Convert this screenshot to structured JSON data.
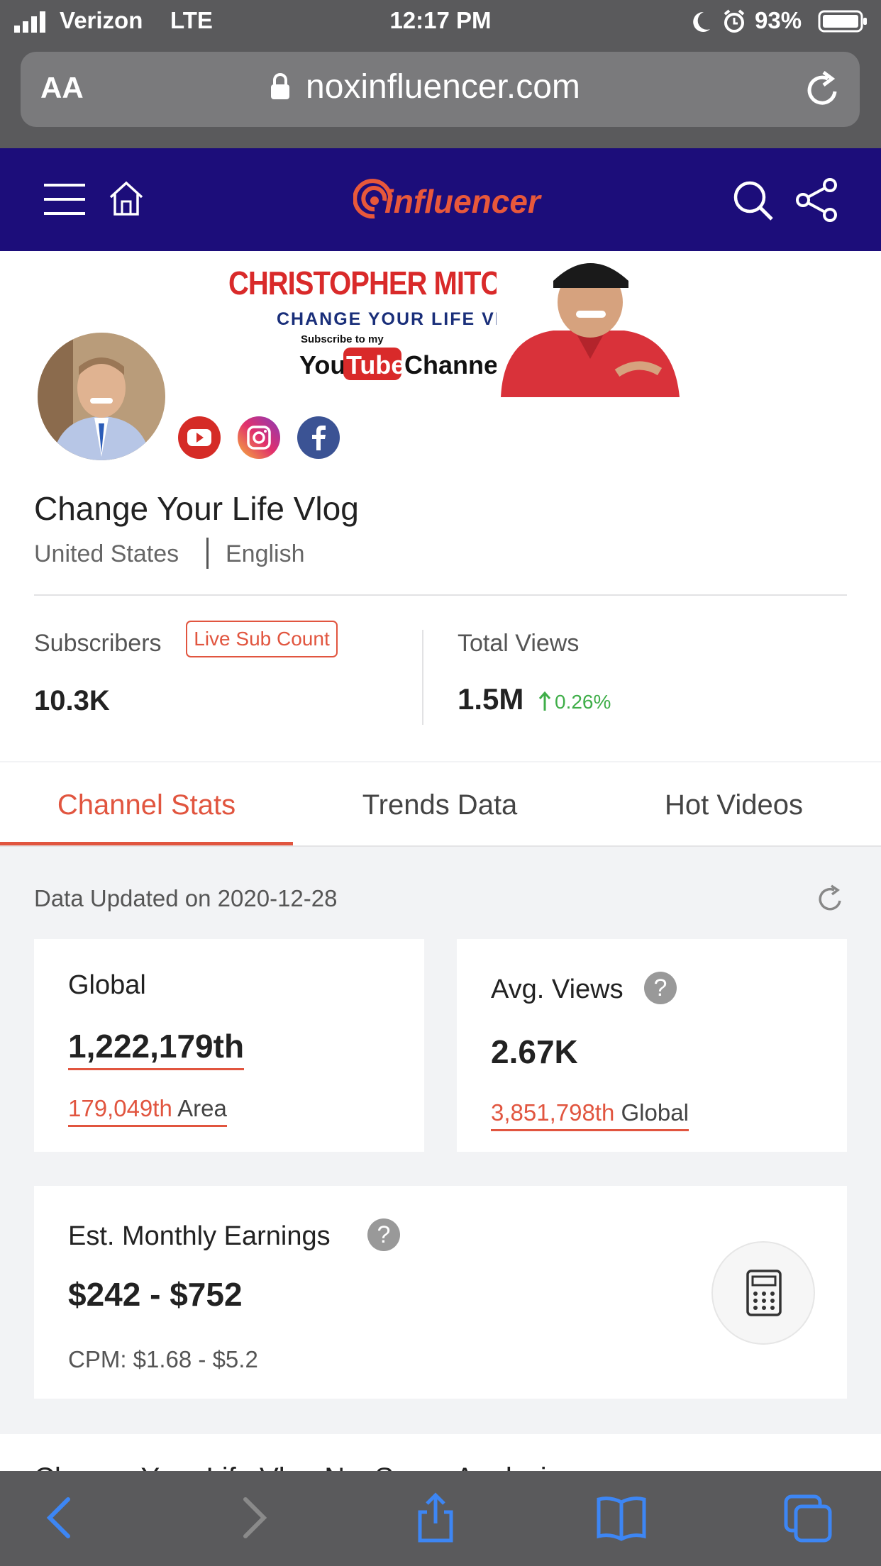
{
  "status_bar": {
    "carrier": "Verizon",
    "network": "LTE",
    "time": "12:17 PM",
    "battery": "93%"
  },
  "browser": {
    "text_size_label": "AA",
    "url": "noxinfluencer.com"
  },
  "site": {
    "logo_text": "influencer",
    "brand_color": "#e8583b",
    "header_color": "#1c0d7a"
  },
  "banner": {
    "name": "CHRISTOPHER MITCHELL",
    "tagline": "CHANGE YOUR LIFE VLOG",
    "subscribe": "Subscribe to my",
    "you": "You",
    "tube": "Tube",
    "channel": "Channel"
  },
  "profile": {
    "channel_name": "Change Your Life Vlog",
    "country": "United States",
    "language": "English",
    "social_icons": [
      "youtube-icon",
      "instagram-icon",
      "facebook-icon"
    ]
  },
  "stats": {
    "subscribers_label": "Subscribers",
    "live_sub_count_label": "Live Sub Count",
    "subscribers_value": "10.3K",
    "total_views_label": "Total Views",
    "total_views_value": "1.5M",
    "total_views_change": "0.26%"
  },
  "tabs": [
    {
      "label": "Channel Stats",
      "active": true
    },
    {
      "label": "Trends Data",
      "active": false
    },
    {
      "label": "Hot Videos",
      "active": false
    }
  ],
  "channel_stats": {
    "updated_text": "Data Updated on 2020-12-28",
    "global_label": "Global",
    "global_rank": "1,222,179th",
    "area_rank": "179,049th",
    "area_label": "Area",
    "avg_views_label": "Avg. Views",
    "avg_views_value": "2.67K",
    "avg_views_rank": "3,851,798th",
    "avg_views_rank_label": "Global",
    "earnings_label": "Est. Monthly Earnings",
    "earnings_value": "$242 - $752",
    "cpm": "CPM: $1.68 - $5.2",
    "next_section_partial": "Change Your Life Vlog NoxScore Analysis"
  }
}
